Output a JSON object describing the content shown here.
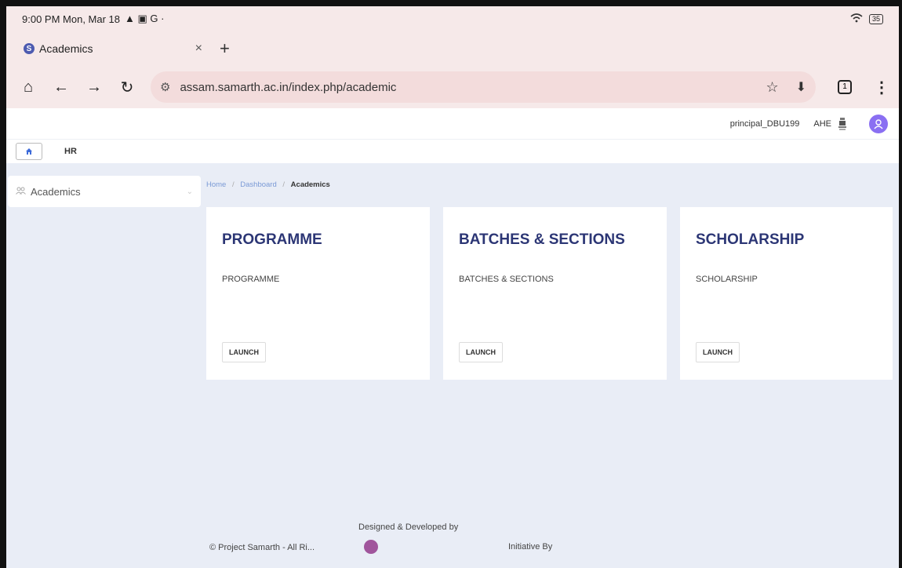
{
  "status_bar": {
    "time": "9:00 PM Mon, Mar 18",
    "indicators": "▲ ▣ G ·",
    "battery": "35"
  },
  "tab": {
    "favicon_letter": "S",
    "title": "Academics",
    "close": "×",
    "new_tab": "+"
  },
  "address_bar": {
    "url": "assam.samarth.ac.in/index.php/academic",
    "tab_count": "1"
  },
  "header": {
    "username": "principal_DBU199",
    "org_code": "AHE"
  },
  "subnav": {
    "item": "HR"
  },
  "sidebar": {
    "item_label": "Academics"
  },
  "breadcrumb": {
    "home": "Home",
    "dashboard": "Dashboard",
    "current": "Academics",
    "separator": "/"
  },
  "cards": [
    {
      "title": "PROGRAMME",
      "description": "PROGRAMME",
      "button": "LAUNCH"
    },
    {
      "title": "BATCHES & SECTIONS",
      "description": "BATCHES & SECTIONS",
      "button": "LAUNCH"
    },
    {
      "title": "SCHOLARSHIP",
      "description": "SCHOLARSHIP",
      "button": "LAUNCH"
    }
  ],
  "footer": {
    "copyright": "© Project Samarth - All Ri...",
    "designed_by": "Designed & Developed by",
    "initiative": "Initiative By"
  },
  "colors": {
    "browser_chrome": "#f6e9e9",
    "page_bg": "#e9edf6",
    "title_text": "#2c3675",
    "accent": "#8a6ff2"
  }
}
